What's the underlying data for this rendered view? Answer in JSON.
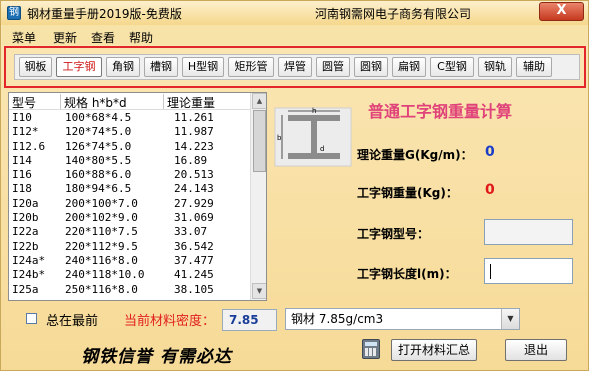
{
  "window": {
    "title": "钢材重量手册2019版-免费版",
    "company": "河南钢需网电子商务有限公司",
    "close_glyph": "X",
    "icon_glyph": "钢"
  },
  "menu": [
    "菜单",
    "更新",
    "查看",
    "帮助"
  ],
  "tabs": [
    {
      "label": "钢板",
      "active": false
    },
    {
      "label": "工字钢",
      "active": true
    },
    {
      "label": "角钢",
      "active": false
    },
    {
      "label": "槽钢",
      "active": false
    },
    {
      "label": "H型钢",
      "active": false
    },
    {
      "label": "矩形管",
      "active": false
    },
    {
      "label": "焊管",
      "active": false
    },
    {
      "label": "圆管",
      "active": false
    },
    {
      "label": "圆钢",
      "active": false
    },
    {
      "label": "扁钢",
      "active": false
    },
    {
      "label": "C型钢",
      "active": false
    },
    {
      "label": "钢轨",
      "active": false
    },
    {
      "label": "辅助",
      "active": false
    }
  ],
  "table": {
    "columns": [
      "型号",
      "规格 h*b*d",
      "理论重量"
    ],
    "rows": [
      [
        "I10",
        "100*68*4.5",
        "11.261"
      ],
      [
        "I12*",
        "120*74*5.0",
        "11.987"
      ],
      [
        "I12.6",
        "126*74*5.0",
        "14.223"
      ],
      [
        "I14",
        "140*80*5.5",
        "16.89"
      ],
      [
        "I16",
        "160*88*6.0",
        "20.513"
      ],
      [
        "I18",
        "180*94*6.5",
        "24.143"
      ],
      [
        "I20a",
        "200*100*7.0",
        "27.929"
      ],
      [
        "I20b",
        "200*102*9.0",
        "31.069"
      ],
      [
        "I22a",
        "220*110*7.5",
        "33.07"
      ],
      [
        "I22b",
        "220*112*9.5",
        "36.542"
      ],
      [
        "I24a*",
        "240*116*8.0",
        "37.477"
      ],
      [
        "I24b*",
        "240*118*10.0",
        "41.245"
      ],
      [
        "I25a",
        "250*116*8.0",
        "38.105"
      ]
    ]
  },
  "calc": {
    "title": "普通工字钢重量计算",
    "diagram_labels": {
      "h": "h",
      "b": "b",
      "d": "d"
    },
    "theory_weight_label": "理论重量G(Kg/m)：",
    "theory_weight_value": "0",
    "total_weight_label": "工字钢重量(Kg)：",
    "total_weight_value": "0",
    "model_label": "工字钢型号：",
    "model_value": "",
    "length_label": "工字钢长度l(m)：",
    "length_value": ""
  },
  "bottom": {
    "always_on_top_label": "总在最前",
    "density_label": "当前材料密度：",
    "density_value": "7.85",
    "material_selected": "钢材 7.85g/cm3",
    "slogan": "钢铁信誉 有需必达",
    "open_summary_button": "打开材料汇总",
    "exit_button": "退出"
  },
  "colors": {
    "accent_red": "#e3262a",
    "title_pink": "#e0437a",
    "blue_value": "#1a3dc8",
    "red_value": "#e01818"
  }
}
